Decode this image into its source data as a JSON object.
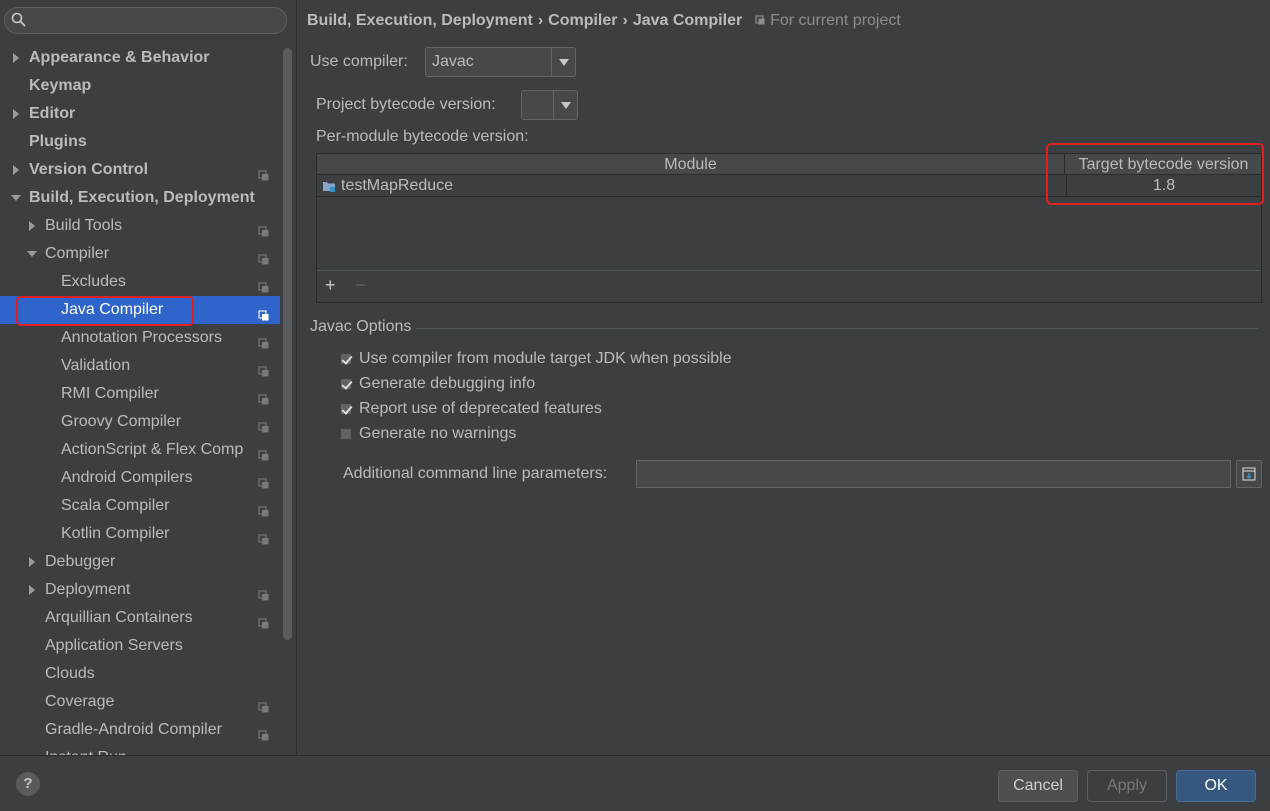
{
  "search": {
    "placeholder": ""
  },
  "tree": [
    {
      "label": "Appearance & Behavior",
      "level": 0,
      "arrow": "right",
      "bold": true,
      "proj": false
    },
    {
      "label": "Keymap",
      "level": 0,
      "arrow": "none",
      "bold": true,
      "proj": false
    },
    {
      "label": "Editor",
      "level": 0,
      "arrow": "right",
      "bold": true,
      "proj": false
    },
    {
      "label": "Plugins",
      "level": 0,
      "arrow": "none",
      "bold": true,
      "proj": false
    },
    {
      "label": "Version Control",
      "level": 0,
      "arrow": "right",
      "bold": true,
      "proj": true
    },
    {
      "label": "Build, Execution, Deployment",
      "level": 0,
      "arrow": "down",
      "bold": true,
      "proj": false
    },
    {
      "label": "Build Tools",
      "level": 1,
      "arrow": "right",
      "bold": false,
      "proj": true
    },
    {
      "label": "Compiler",
      "level": 1,
      "arrow": "down",
      "bold": false,
      "proj": true
    },
    {
      "label": "Excludes",
      "level": 2,
      "arrow": "none",
      "bold": false,
      "proj": true
    },
    {
      "label": "Java Compiler",
      "level": 2,
      "arrow": "none",
      "bold": false,
      "proj": true,
      "selected": true
    },
    {
      "label": "Annotation Processors",
      "level": 2,
      "arrow": "none",
      "bold": false,
      "proj": true
    },
    {
      "label": "Validation",
      "level": 2,
      "arrow": "none",
      "bold": false,
      "proj": true
    },
    {
      "label": "RMI Compiler",
      "level": 2,
      "arrow": "none",
      "bold": false,
      "proj": true
    },
    {
      "label": "Groovy Compiler",
      "level": 2,
      "arrow": "none",
      "bold": false,
      "proj": true
    },
    {
      "label": "ActionScript & Flex Comp",
      "level": 2,
      "arrow": "none",
      "bold": false,
      "proj": true
    },
    {
      "label": "Android Compilers",
      "level": 2,
      "arrow": "none",
      "bold": false,
      "proj": true
    },
    {
      "label": "Scala Compiler",
      "level": 2,
      "arrow": "none",
      "bold": false,
      "proj": true
    },
    {
      "label": "Kotlin Compiler",
      "level": 2,
      "arrow": "none",
      "bold": false,
      "proj": true
    },
    {
      "label": "Debugger",
      "level": 1,
      "arrow": "right",
      "bold": false,
      "proj": false
    },
    {
      "label": "Deployment",
      "level": 1,
      "arrow": "right",
      "bold": false,
      "proj": true
    },
    {
      "label": "Arquillian Containers",
      "level": 1,
      "arrow": "none",
      "bold": false,
      "proj": true
    },
    {
      "label": "Application Servers",
      "level": 1,
      "arrow": "none",
      "bold": false,
      "proj": false
    },
    {
      "label": "Clouds",
      "level": 1,
      "arrow": "none",
      "bold": false,
      "proj": false
    },
    {
      "label": "Coverage",
      "level": 1,
      "arrow": "none",
      "bold": false,
      "proj": true
    },
    {
      "label": "Gradle-Android Compiler",
      "level": 1,
      "arrow": "none",
      "bold": false,
      "proj": true
    },
    {
      "label": "Instant Run",
      "level": 1,
      "arrow": "none",
      "bold": false,
      "proj": false
    }
  ],
  "breadcrumb": {
    "parts": [
      "Build, Execution, Deployment",
      "Compiler",
      "Java Compiler"
    ],
    "separator": "›",
    "scope": "For current project"
  },
  "compiler": {
    "use_label": "Use compiler:",
    "use_value": "Javac",
    "project_bytecode_label": "Project bytecode version:",
    "project_bytecode_value": "",
    "per_module_label": "Per-module bytecode version:"
  },
  "module_table": {
    "col_module": "Module",
    "col_target": "Target bytecode version",
    "rows": [
      {
        "module": "testMapReduce",
        "target": "1.8"
      }
    ],
    "add_label": "+",
    "remove_label": "−"
  },
  "javac": {
    "title": "Javac Options",
    "options": [
      {
        "label": "Use compiler from module target JDK when possible",
        "checked": true
      },
      {
        "label": "Generate debugging info",
        "checked": true
      },
      {
        "label": "Report use of deprecated features",
        "checked": true
      },
      {
        "label": "Generate no warnings",
        "checked": false
      }
    ],
    "additional_label": "Additional command line parameters:",
    "additional_value": ""
  },
  "footer": {
    "help": "?",
    "cancel": "Cancel",
    "apply": "Apply",
    "ok": "OK"
  },
  "colors": {
    "background": "#3c3f41",
    "selection": "#2f65ca",
    "highlight_box": "#e0201f",
    "ok_button": "#365880"
  }
}
